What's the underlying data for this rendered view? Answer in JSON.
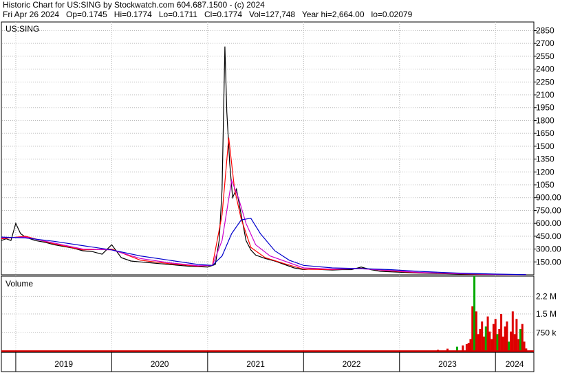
{
  "header": {
    "title": "Historic Chart for US:SING by Stockwatch.com 604.687.1500 - (c) 2024",
    "quote": "Fri Apr 26 2024   Op=0.1745   Hi=0.1774   Lo=0.1711   Cl=0.1774   Vol=127,748   Year hi=2,664.00   lo=0.02079"
  },
  "price_panel": {
    "symbol_label": "US:SING"
  },
  "volume_panel": {
    "label": "Volume"
  },
  "colors": {
    "price": "#000000",
    "ma_short": "#ff0000",
    "ma_mid": "#cc00cc",
    "ma_long": "#0000cc",
    "volume": "#dd0000",
    "volume_up": "#00aa00",
    "grid": "#bbbbbb"
  },
  "chart_data": [
    {
      "type": "line",
      "panel": "price",
      "y_ticks": [
        150,
        300,
        450,
        600,
        750,
        900,
        1050,
        1200,
        1350,
        1500,
        1650,
        1800,
        1950,
        2100,
        2250,
        2400,
        2550,
        2700,
        2850
      ],
      "y_tick_labels": [
        "150.00",
        "300.00",
        "450.00",
        "600.00",
        "750.00",
        "900.00",
        "1050",
        "1200",
        "1350",
        "1500",
        "1650",
        "1800",
        "1950",
        "2100",
        "2250",
        "2400",
        "2550",
        "2700",
        "2850"
      ],
      "ylim": [
        0,
        2950
      ],
      "x_ticks": [
        "2019",
        "2020",
        "2021",
        "2022",
        "2023",
        "2024"
      ],
      "xlim": [
        2018.85,
        2024.4
      ],
      "grid": true,
      "series": [
        {
          "role": "price",
          "x": [
            2018.85,
            2018.9,
            2018.95,
            2019.0,
            2019.05,
            2019.1,
            2019.2,
            2019.3,
            2019.4,
            2019.5,
            2019.6,
            2019.7,
            2019.8,
            2019.9,
            2020.0,
            2020.1,
            2020.2,
            2020.3,
            2020.4,
            2020.5,
            2020.6,
            2020.7,
            2020.75,
            2020.8,
            2020.9,
            2021.0,
            2021.08,
            2021.12,
            2021.15,
            2021.18,
            2021.2,
            2021.23,
            2021.26,
            2021.3,
            2021.35,
            2021.4,
            2021.45,
            2021.5,
            2021.55,
            2021.6,
            2021.7,
            2021.8,
            2021.9,
            2022.0,
            2022.1,
            2022.2,
            2022.3,
            2022.4,
            2022.5,
            2022.6,
            2022.7,
            2022.8,
            2023.0,
            2023.2,
            2023.4,
            2023.6,
            2023.8,
            2024.0,
            2024.2,
            2024.32
          ],
          "y": [
            400,
            420,
            400,
            600,
            480,
            440,
            400,
            380,
            350,
            330,
            310,
            280,
            270,
            240,
            350,
            200,
            160,
            150,
            140,
            130,
            120,
            110,
            105,
            100,
            95,
            90,
            120,
            400,
            1000,
            2664,
            1900,
            1300,
            900,
            1000,
            700,
            400,
            290,
            230,
            210,
            190,
            160,
            120,
            80,
            60,
            70,
            60,
            55,
            60,
            60,
            90,
            60,
            40,
            30,
            20,
            15,
            10,
            5,
            2,
            1,
            0.18
          ]
        },
        {
          "role": "ma_short",
          "x": [
            2018.85,
            2019.1,
            2019.4,
            2019.7,
            2020.0,
            2020.3,
            2020.6,
            2020.9,
            2021.05,
            2021.15,
            2021.22,
            2021.28,
            2021.35,
            2021.45,
            2021.6,
            2021.8,
            2022.0,
            2022.3,
            2022.6,
            2022.9,
            2023.2,
            2023.6,
            2024.0,
            2024.32
          ],
          "y": [
            420,
            450,
            360,
            290,
            300,
            170,
            130,
            100,
            110,
            700,
            1600,
            1000,
            650,
            320,
            200,
            130,
            65,
            60,
            75,
            45,
            25,
            12,
            4,
            1
          ]
        },
        {
          "role": "ma_mid",
          "x": [
            2018.85,
            2019.1,
            2019.4,
            2019.7,
            2020.0,
            2020.3,
            2020.6,
            2020.9,
            2021.05,
            2021.15,
            2021.25,
            2021.32,
            2021.4,
            2021.5,
            2021.65,
            2021.85,
            2022.0,
            2022.3,
            2022.6,
            2022.9,
            2023.2,
            2023.6,
            2024.0,
            2024.32
          ],
          "y": [
            430,
            440,
            370,
            300,
            290,
            190,
            140,
            105,
            110,
            400,
            1100,
            900,
            600,
            350,
            220,
            140,
            80,
            65,
            70,
            50,
            28,
            14,
            5,
            1
          ]
        },
        {
          "role": "ma_long",
          "x": [
            2018.85,
            2019.1,
            2019.4,
            2019.7,
            2020.0,
            2020.3,
            2020.6,
            2020.9,
            2021.05,
            2021.15,
            2021.25,
            2021.35,
            2021.45,
            2021.55,
            2021.7,
            2021.85,
            2022.0,
            2022.3,
            2022.6,
            2022.9,
            2023.2,
            2023.6,
            2024.0,
            2024.32
          ],
          "y": [
            440,
            430,
            390,
            340,
            290,
            220,
            170,
            120,
            110,
            220,
            480,
            640,
            660,
            480,
            280,
            170,
            110,
            80,
            72,
            60,
            40,
            20,
            8,
            2
          ]
        }
      ]
    },
    {
      "type": "bar",
      "panel": "volume",
      "y_ticks": [
        750000,
        1500000,
        2200000
      ],
      "y_tick_labels": [
        "750 k",
        "1.5 M",
        "2.2 M"
      ],
      "ylim": [
        0,
        3000000
      ],
      "x": [
        2023.0,
        2023.1,
        2023.2,
        2023.3,
        2023.4,
        2023.5,
        2023.6,
        2023.66,
        2023.7,
        2023.72,
        2023.74,
        2023.76,
        2023.78,
        2023.8,
        2023.82,
        2023.84,
        2023.86,
        2023.88,
        2023.9,
        2023.92,
        2023.94,
        2023.96,
        2023.98,
        2024.0,
        2024.02,
        2024.04,
        2024.06,
        2024.08,
        2024.1,
        2024.12,
        2024.14,
        2024.16,
        2024.18,
        2024.2,
        2024.22,
        2024.24,
        2024.26,
        2024.28,
        2024.3,
        2024.32
      ],
      "values": [
        20000,
        30000,
        50000,
        40000,
        80000,
        120000,
        200000,
        250000,
        300000,
        350000,
        500000,
        1800000,
        3000000,
        1600000,
        700000,
        900000,
        1200000,
        600000,
        1000000,
        1400000,
        800000,
        500000,
        1100000,
        1300000,
        700000,
        900000,
        1500000,
        600000,
        1000000,
        1200000,
        400000,
        800000,
        1600000,
        700000,
        1300000,
        500000,
        900000,
        1100000,
        400000,
        127748
      ]
    }
  ]
}
